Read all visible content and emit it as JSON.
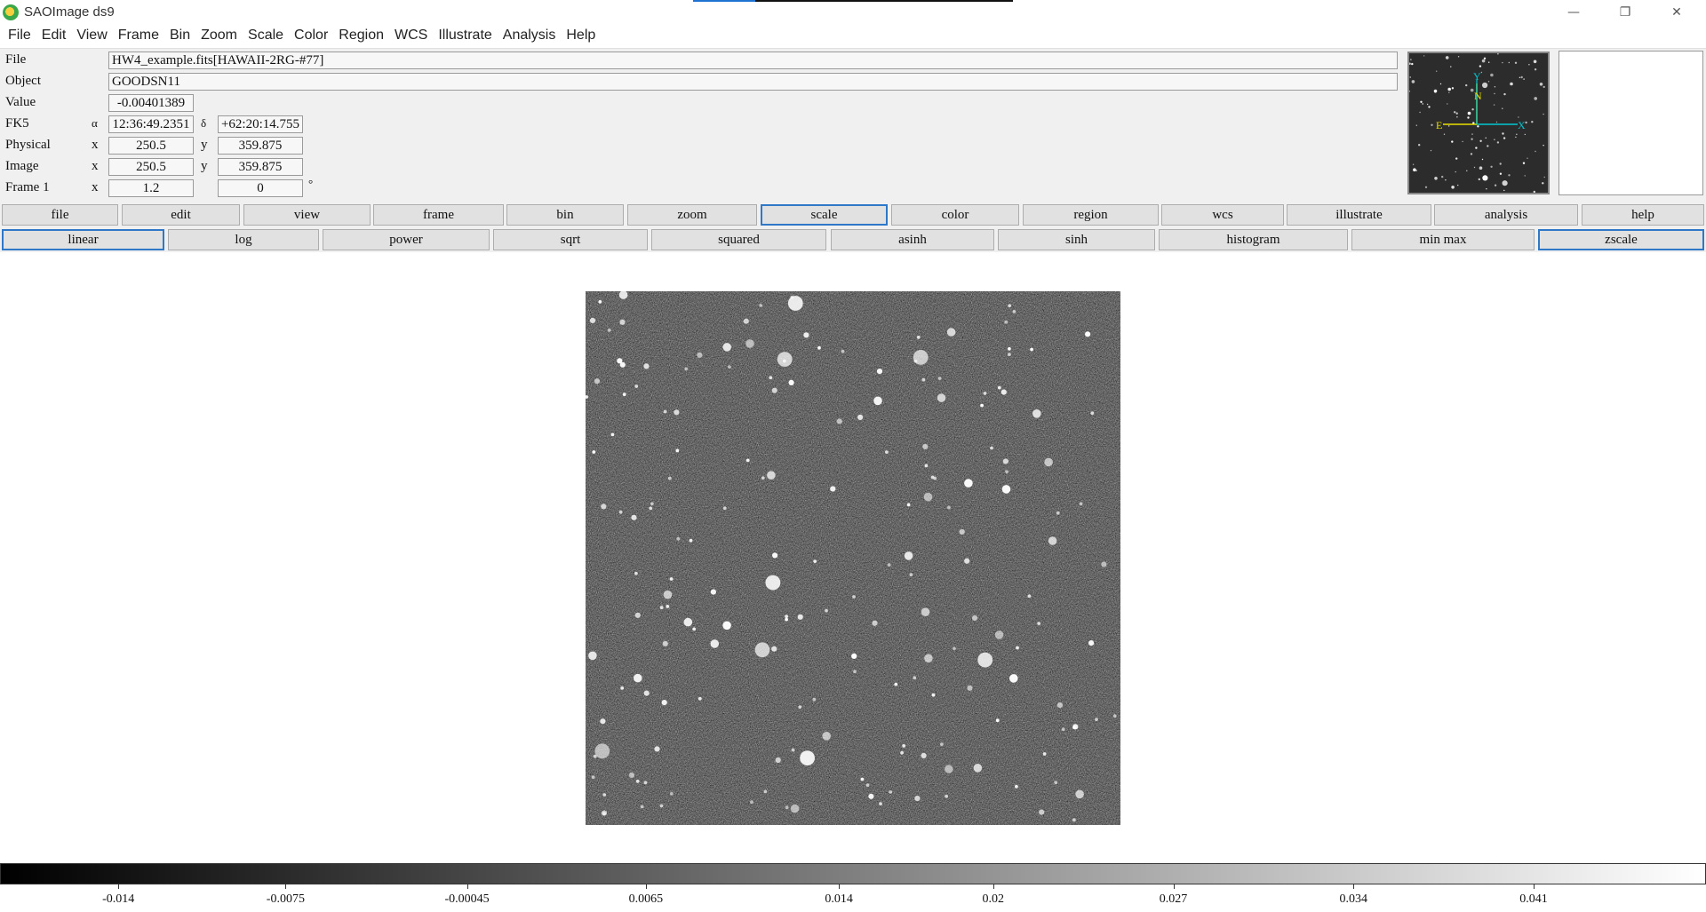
{
  "window": {
    "title": "SAOImage ds9",
    "minimize_glyph": "—",
    "restore_glyph": "❐",
    "close_glyph": "✕"
  },
  "menu": [
    "File",
    "Edit",
    "View",
    "Frame",
    "Bin",
    "Zoom",
    "Scale",
    "Color",
    "Region",
    "WCS",
    "Illustrate",
    "Analysis",
    "Help"
  ],
  "info": {
    "file_label": "File",
    "file_value": "HW4_example.fits[HAWAII-2RG-#77]",
    "object_label": "Object",
    "object_value": "GOODSN11",
    "value_label": "Value",
    "value_value": "-0.00401389",
    "fk5_label": "FK5",
    "alpha_symbol": "α",
    "ra_value": "12:36:49.2351",
    "delta_symbol": "δ",
    "dec_value": "+62:20:14.755",
    "physical_label": "Physical",
    "x_label": "x",
    "y_label": "y",
    "physical_x": "250.5",
    "physical_y": "359.875",
    "image_label": "Image",
    "image_x": "250.5",
    "image_y": "359.875",
    "frame_label": "Frame 1",
    "frame_zoom": "1.2",
    "frame_angle": "0",
    "degree_symbol": "°"
  },
  "panner": {
    "north_label": "N",
    "east_label": "E",
    "x_label": "X",
    "y_label": "Y",
    "axis_color": "#00c8d0",
    "compass_color": "#e8e000"
  },
  "buttonbar": {
    "main": [
      "file",
      "edit",
      "view",
      "frame",
      "bin",
      "zoom",
      "scale",
      "color",
      "region",
      "wcs",
      "illustrate",
      "analysis",
      "help"
    ],
    "main_selected": "scale",
    "scale": [
      "linear",
      "log",
      "power",
      "sqrt",
      "squared",
      "asinh",
      "sinh",
      "histogram",
      "min max",
      "zscale"
    ],
    "scale_selected": [
      "linear",
      "zscale"
    ]
  },
  "colorbar": {
    "colormap": "grey",
    "ticks": [
      {
        "value": -0.014,
        "label": "-0.014"
      },
      {
        "value": -0.0075,
        "label": "-0.0075"
      },
      {
        "value": -0.00045,
        "label": "-0.00045"
      },
      {
        "value": 0.0065,
        "label": "0.0065"
      },
      {
        "value": 0.014,
        "label": "0.014"
      },
      {
        "value": 0.02,
        "label": "0.02"
      },
      {
        "value": 0.027,
        "label": "0.027"
      },
      {
        "value": 0.034,
        "label": "0.034"
      },
      {
        "value": 0.041,
        "label": "0.041"
      }
    ],
    "range": [
      -0.0186,
      0.0477
    ]
  },
  "colors": {
    "selected_border": "#2f78c8",
    "button_bg": "#e1e1e1",
    "panel_bg": "#f0f0f0"
  }
}
